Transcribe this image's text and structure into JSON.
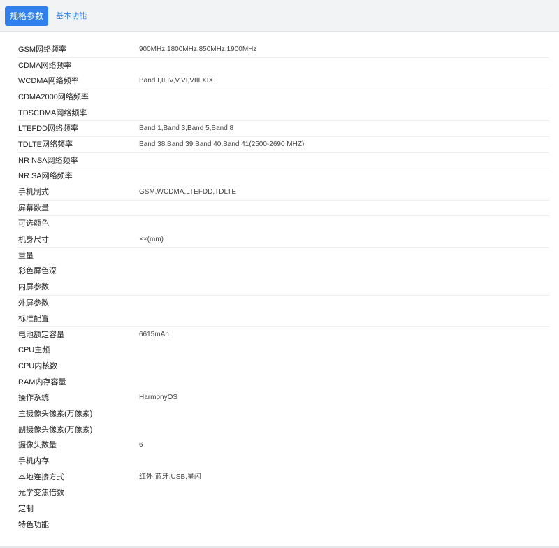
{
  "tabs": {
    "active_label": "规格参数",
    "other_label": "基本功能"
  },
  "specs": [
    {
      "label": "GSM网络频率",
      "value": "900MHz,1800MHz,850MHz,1900MHz",
      "sep": true
    },
    {
      "label": "CDMA网络频率",
      "value": "",
      "sep": false
    },
    {
      "label": "WCDMA网络频率",
      "value": "Band Ⅰ,II,IV,V,VI,VIII,XIX",
      "sep": true
    },
    {
      "label": "CDMA2000网络频率",
      "value": "",
      "sep": false
    },
    {
      "label": "TDSCDMA网络频率",
      "value": "",
      "sep": true
    },
    {
      "label": "LTEFDD网络频率",
      "value": "Band 1,Band 3,Band 5,Band 8",
      "sep": true
    },
    {
      "label": "TDLTE网络频率",
      "value": "Band 38,Band 39,Band 40,Band 41(2500-2690 MHZ)",
      "sep": true
    },
    {
      "label": "NR NSA网络频率",
      "value": "",
      "sep": true
    },
    {
      "label": "NR SA网络频率",
      "value": "",
      "sep": false
    },
    {
      "label": "手机制式",
      "value": "GSM,WCDMA,LTEFDD,TDLTE",
      "sep": true
    },
    {
      "label": "屏幕数量",
      "value": "",
      "sep": true
    },
    {
      "label": "可选颜色",
      "value": "",
      "sep": false
    },
    {
      "label": "机身尺寸",
      "value": "××(mm)",
      "sep": true
    },
    {
      "label": "重量",
      "value": "",
      "sep": false
    },
    {
      "label": "彩色屏色深",
      "value": "",
      "sep": false
    },
    {
      "label": "内屏参数",
      "value": "",
      "sep": true
    },
    {
      "label": "外屏参数",
      "value": "",
      "sep": false
    },
    {
      "label": "标准配置",
      "value": "",
      "sep": true
    },
    {
      "label": "电池额定容量",
      "value": "6615mAh",
      "sep": false
    },
    {
      "label": "CPU主频",
      "value": "",
      "sep": false
    },
    {
      "label": "CPU内核数",
      "value": "",
      "sep": false
    },
    {
      "label": "RAM内存容量",
      "value": "",
      "sep": false
    },
    {
      "label": "操作系统",
      "value": "HarmonyOS",
      "sep": false
    },
    {
      "label": "主摄像头像素(万像素)",
      "value": "",
      "sep": false
    },
    {
      "label": "副摄像头像素(万像素)",
      "value": "",
      "sep": false
    },
    {
      "label": "摄像头数量",
      "value": "6",
      "sep": false
    },
    {
      "label": "手机内存",
      "value": "",
      "sep": false
    },
    {
      "label": "本地连接方式",
      "value": "红外,蓝牙,USB,星闪",
      "sep": false
    },
    {
      "label": "光学变焦倍数",
      "value": "",
      "sep": false
    },
    {
      "label": "定制",
      "value": "",
      "sep": false
    },
    {
      "label": "特色功能",
      "value": "",
      "sep": false
    }
  ]
}
